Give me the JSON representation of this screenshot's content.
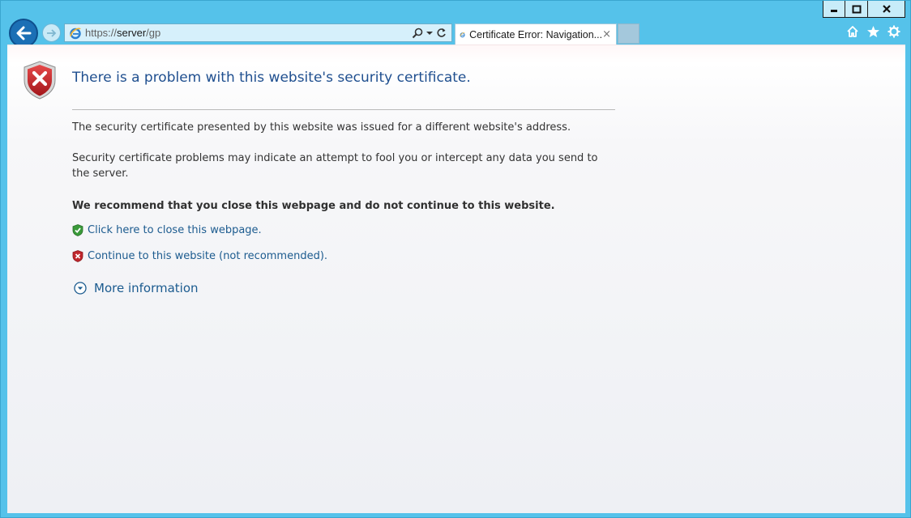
{
  "window": {
    "caption_buttons": [
      "minimize",
      "maximize",
      "close"
    ]
  },
  "addressbar": {
    "url_scheme": "https://",
    "url_host": "server",
    "url_path": "/gp"
  },
  "tab": {
    "title": "Certificate Error: Navigation...",
    "close_glyph": "×"
  },
  "content": {
    "title": "There is a problem with this website's security certificate.",
    "paragraph1": "The security certificate presented by this website was issued for a different website's address.",
    "paragraph2": "Security certificate problems may indicate an attempt to fool you or intercept any data you send to the server.",
    "recommendation": "We recommend that you close this webpage and do not continue to this website.",
    "close_link": "Click here to close this webpage.",
    "continue_link": "Continue to this website (not recommended).",
    "more_info": "More information"
  },
  "colors": {
    "frame": "#55c2ea",
    "title_blue": "#1f4f8f",
    "link_blue": "#1c5b8f",
    "shield_red": "#c0272d",
    "shield_green": "#3a9a3a"
  }
}
